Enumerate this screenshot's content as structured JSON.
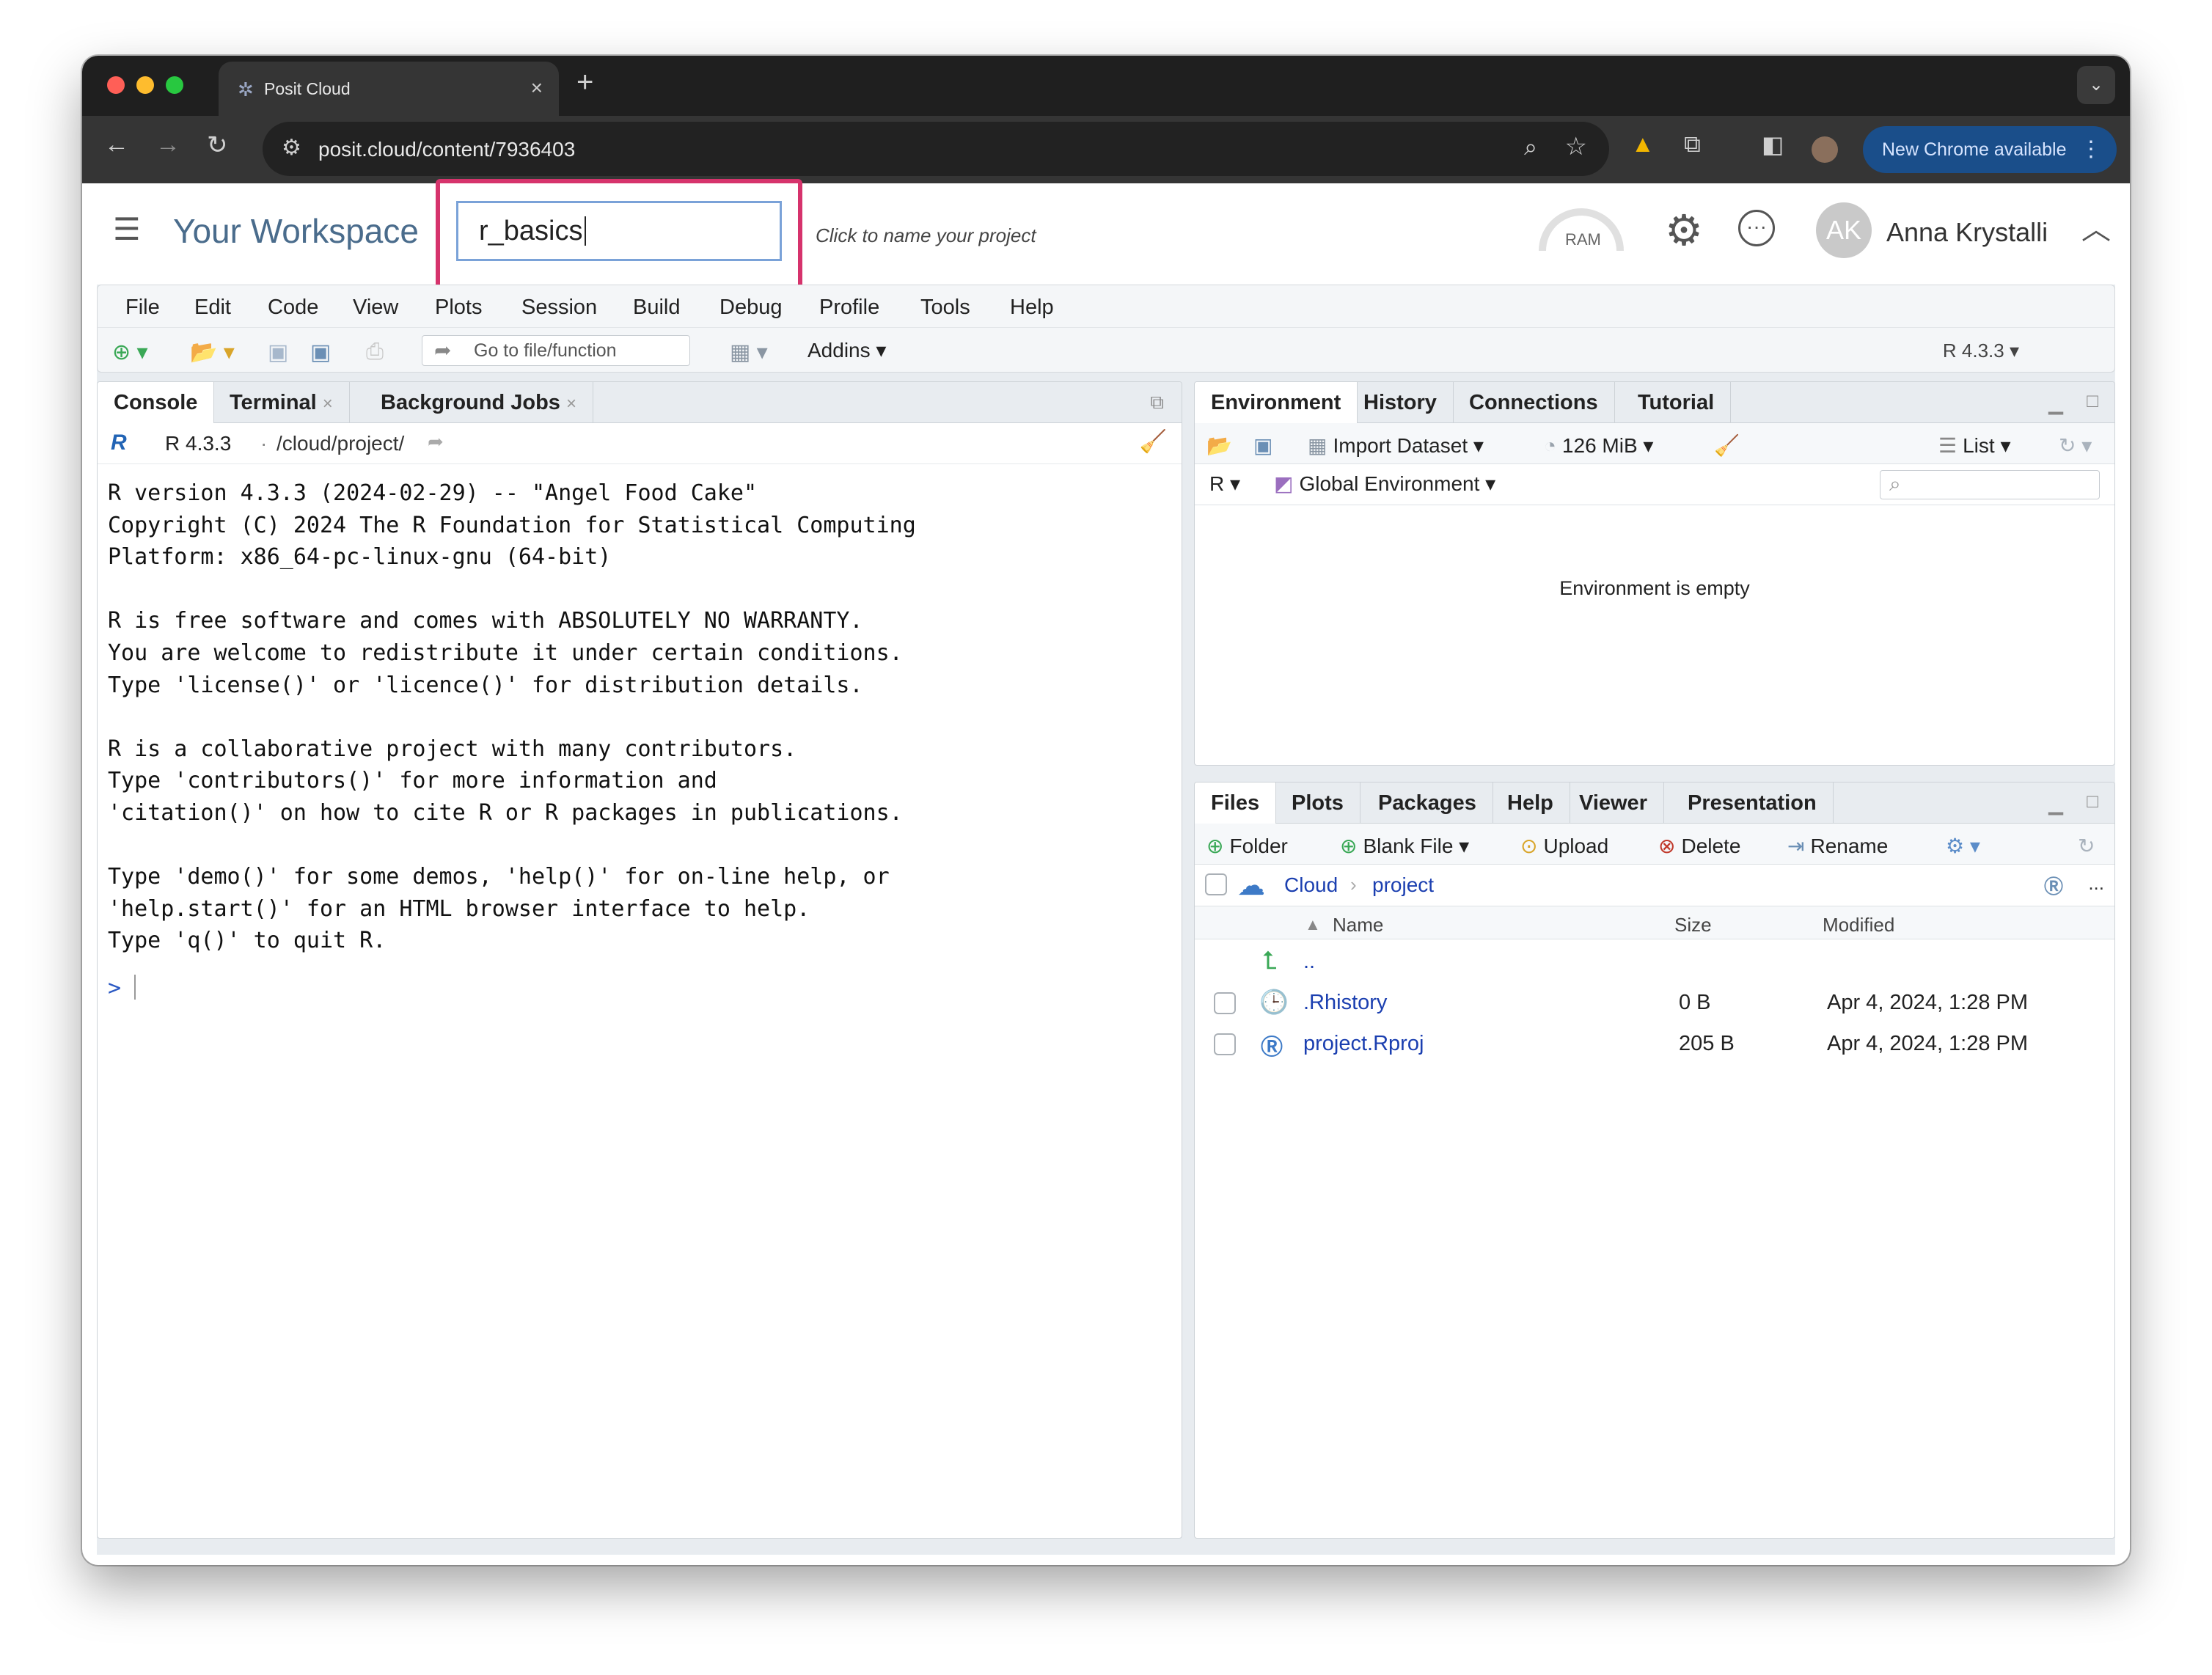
{
  "browser": {
    "tab_title": "Posit Cloud",
    "url": "posit.cloud/content/7936403",
    "update_button": "New Chrome available"
  },
  "posit": {
    "workspace_label": "Your Workspace",
    "project_name_value": "r_basics",
    "project_name_hint": "Click to name your project",
    "ram_label": "RAM",
    "avatar_initials": "AK",
    "user_name": "Anna Krystalli"
  },
  "menubar": [
    "File",
    "Edit",
    "Code",
    "View",
    "Plots",
    "Session",
    "Build",
    "Debug",
    "Profile",
    "Tools",
    "Help"
  ],
  "toolbar": {
    "goto_placeholder": "Go to file/function",
    "addins_label": "Addins",
    "r_version": "R 4.3.3"
  },
  "console_pane": {
    "tabs": [
      "Console",
      "Terminal",
      "Background Jobs"
    ],
    "version": "R 4.3.3",
    "separator": "·",
    "path": "/cloud/project/",
    "output_lines": [
      "R version 4.3.3 (2024-02-29) -- \"Angel Food Cake\"",
      "Copyright (C) 2024 The R Foundation for Statistical Computing",
      "Platform: x86_64-pc-linux-gnu (64-bit)",
      "",
      "R is free software and comes with ABSOLUTELY NO WARRANTY.",
      "You are welcome to redistribute it under certain conditions.",
      "Type 'license()' or 'licence()' for distribution details.",
      "",
      "R is a collaborative project with many contributors.",
      "Type 'contributors()' for more information and",
      "'citation()' on how to cite R or R packages in publications.",
      "",
      "Type 'demo()' for some demos, 'help()' for on-line help, or",
      "'help.start()' for an HTML browser interface to help.",
      "Type 'q()' to quit R."
    ],
    "prompt": ">"
  },
  "environment_pane": {
    "tabs": [
      "Environment",
      "History",
      "Connections",
      "Tutorial"
    ],
    "import_label": "Import Dataset",
    "memory_label": "126 MiB",
    "list_label": "List",
    "language": "R",
    "scope": "Global Environment",
    "empty_message": "Environment is empty"
  },
  "files_pane": {
    "tabs": [
      "Files",
      "Plots",
      "Packages",
      "Help",
      "Viewer",
      "Presentation"
    ],
    "actions": {
      "folder": "Folder",
      "blank_file": "Blank File",
      "upload": "Upload",
      "delete": "Delete",
      "rename": "Rename"
    },
    "breadcrumb": [
      "Cloud",
      "project"
    ],
    "more": "...",
    "columns": {
      "name": "Name",
      "size": "Size",
      "modified": "Modified"
    },
    "parent_link": "..",
    "files": [
      {
        "name": ".Rhistory",
        "size": "0 B",
        "modified": "Apr 4, 2024, 1:28 PM"
      },
      {
        "name": "project.Rproj",
        "size": "205 B",
        "modified": "Apr 4, 2024, 1:28 PM"
      }
    ]
  },
  "colors": {
    "highlight": "#d6336c",
    "workspace": "#4a6c8c",
    "link": "#1b3fb0"
  }
}
